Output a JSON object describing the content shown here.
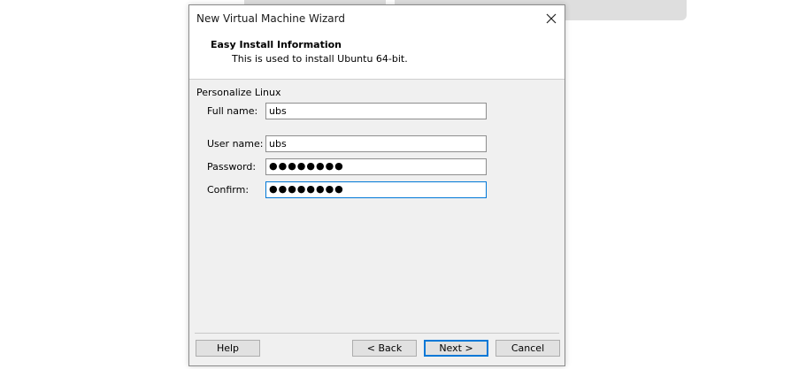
{
  "dialog": {
    "title": "New Virtual Machine Wizard",
    "close_label": "×"
  },
  "header": {
    "title": "Easy Install Information",
    "subtitle": "This is used to install Ubuntu 64-bit."
  },
  "form": {
    "group_label": "Personalize Linux",
    "full_name_label": "Full name:",
    "full_name_value": "ubs",
    "user_name_label": "User name:",
    "user_name_value": "ubs",
    "password_label": "Password:",
    "password_value": "●●●●●●●●",
    "confirm_label": "Confirm:",
    "confirm_value": "●●●●●●●●"
  },
  "buttons": {
    "help": "Help",
    "back": "< Back",
    "next": "Next >",
    "cancel": "Cancel"
  }
}
